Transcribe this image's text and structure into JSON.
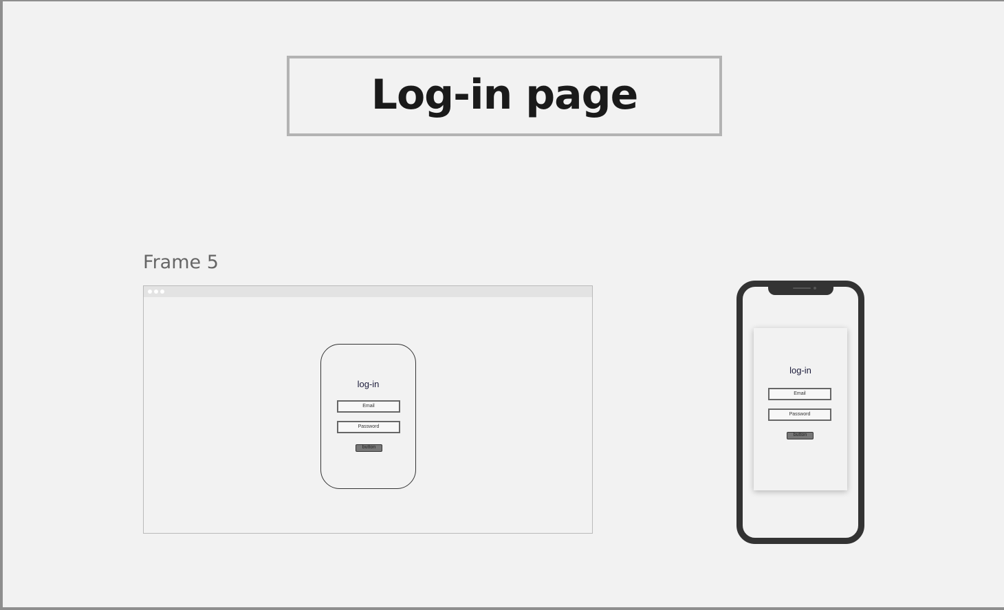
{
  "page": {
    "title": "Log-in page",
    "frame_label": "Frame 5"
  },
  "desktop_login": {
    "title": "log-in",
    "email_placeholder": "Email",
    "password_placeholder": "Password",
    "button_label": "button"
  },
  "mobile_login": {
    "title": "log-in",
    "email_placeholder": "Email",
    "password_placeholder": "Password",
    "button_label": "button"
  },
  "colors": {
    "canvas_background": "#f2f2f2",
    "title_border": "#b3b3b3",
    "phone_frame": "#333333",
    "button_fill": "#777777"
  },
  "icons": {
    "browser_window_dots": "three-dots-icon",
    "phone_speaker": "speaker-icon",
    "phone_camera": "camera-icon"
  }
}
